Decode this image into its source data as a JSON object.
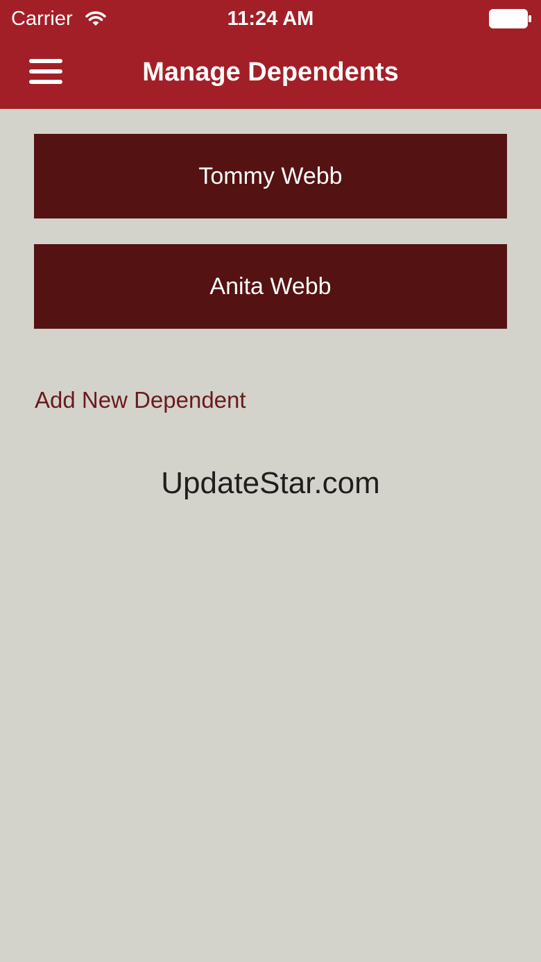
{
  "status_bar": {
    "carrier": "Carrier",
    "time": "11:24 AM",
    "wifi_icon": "wifi-icon",
    "battery_icon": "battery-icon"
  },
  "nav": {
    "menu_icon": "hamburger-menu-icon",
    "title": "Manage Dependents"
  },
  "dependents": [
    {
      "name": "Tommy Webb"
    },
    {
      "name": "Anita Webb"
    }
  ],
  "add_dependent_label": "Add New Dependent",
  "watermark": "UpdateStar.com",
  "colors": {
    "header": "#a21f27",
    "dependent_button": "#551213",
    "background": "#d3d3cb",
    "link": "#6b1a1d"
  }
}
